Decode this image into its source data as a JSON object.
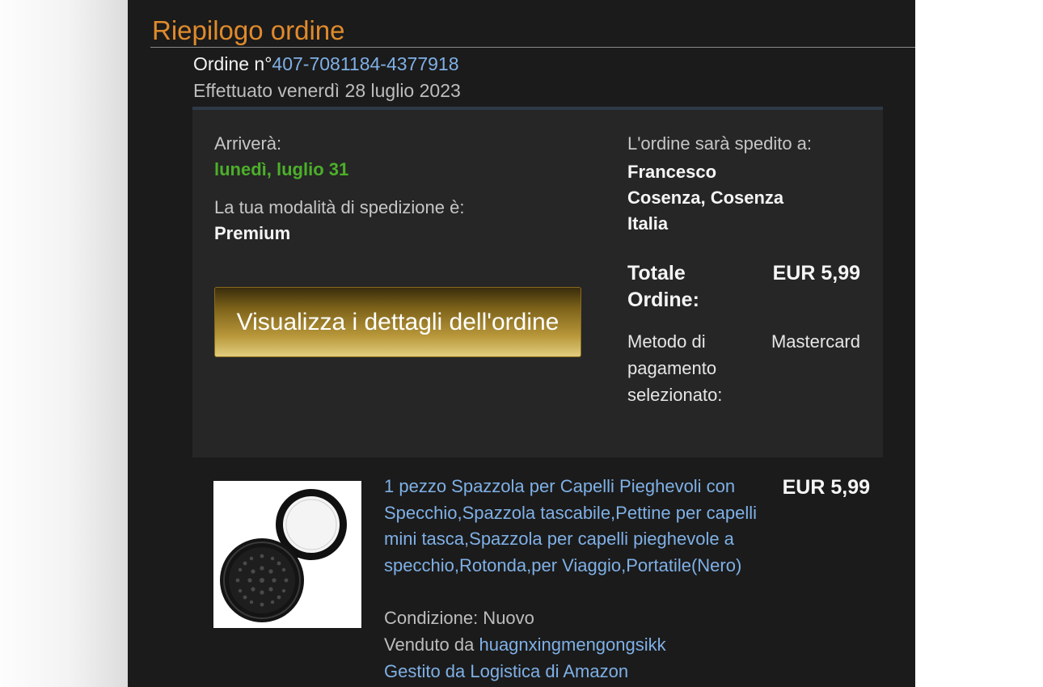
{
  "page": {
    "title": "Riepilogo ordine"
  },
  "order": {
    "number_prefix": "Ordine n°",
    "number": "407-7081184-4377918",
    "placed": "Effettuato venerdì 28 luglio 2023"
  },
  "delivery": {
    "arrives_label": "Arriverà:",
    "arrives_date": "lunedì, luglio 31",
    "shipping_mode_label": "La tua modalità di spedizione è:",
    "shipping_mode": "Premium"
  },
  "shipping_address": {
    "label": "L'ordine sarà spedito a:",
    "name": "Francesco",
    "city": "Cosenza, Cosenza",
    "country": "Italia"
  },
  "actions": {
    "view_details_label": "Visualizza i dettagli dell'ordine"
  },
  "totals": {
    "total_label": "Totale Ordine:",
    "total_value": "EUR 5,99",
    "payment_label": "Metodo di pagamento selezionato:",
    "payment_value": "Mastercard"
  },
  "item": {
    "title": "1 pezzo Spazzola per Capelli Pieghevoli con Specchio,Spazzola tascabile,Pettine per capelli mini tasca,Spazzola per capelli pieghevole a specchio,Rotonda,per Viaggio,Portatile(Nero)",
    "price": "EUR 5,99",
    "condition": "Condizione: Nuovo",
    "sold_by_label": "Venduto da",
    "seller": "huagnxingmengongsikk",
    "fulfilled_by": "Gestito da Logistica di Amazon"
  },
  "colors": {
    "title_orange": "#e08a2c",
    "link_blue": "#7fb0e6",
    "delivery_green": "#4caf2a",
    "panel_bg": "#1b1b1b",
    "box_bg": "#262626"
  },
  "icons": {
    "product_image": "folding-mirror-hairbrush-image"
  }
}
